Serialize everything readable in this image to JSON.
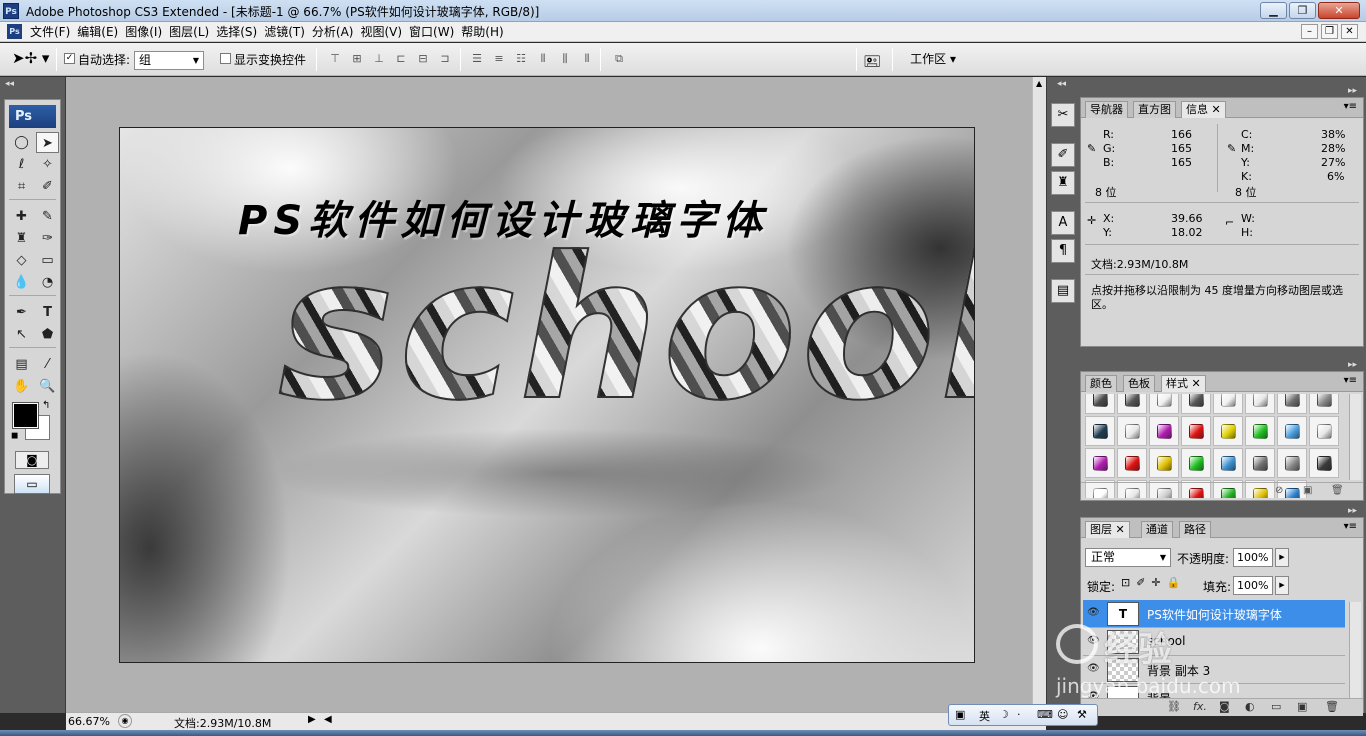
{
  "window": {
    "logo": "Ps",
    "title": "Adobe Photoshop CS3 Extended - [未标题-1 @ 66.7% (PS软件如何设计玻璃字体, RGB/8)]",
    "btn_min": "▁",
    "btn_max": "❐",
    "btn_close": "✕"
  },
  "menu": {
    "items": [
      "文件(F)",
      "编辑(E)",
      "图像(I)",
      "图层(L)",
      "选择(S)",
      "滤镜(T)",
      "分析(A)",
      "视图(V)",
      "窗口(W)",
      "帮助(H)"
    ],
    "doc_min": "–",
    "doc_max": "❐",
    "doc_close": "✕"
  },
  "options": {
    "auto_select_label": "自动选择:",
    "auto_select_value": "组",
    "show_transform_label": "显示变换控件",
    "workspace_label": "工作区 ▾"
  },
  "canvas": {
    "title_text": "PS软件如何设计玻璃字体",
    "school_text": "school"
  },
  "status": {
    "zoom": "66.67%",
    "doc": "文档:2.93M/10.8M"
  },
  "info_panel": {
    "tabs": [
      "导航器",
      "直方图",
      "信息"
    ],
    "r_label": "R:",
    "r_value": "166",
    "g_label": "G:",
    "g_value": "165",
    "b_label": "B:",
    "b_value": "165",
    "bit_left": "8 位",
    "c_label": "C:",
    "c_value": "38%",
    "m_label": "M:",
    "m_value": "28%",
    "y_label": "Y:",
    "y_value": "27%",
    "k_label": "K:",
    "k_value": "6%",
    "bit_right": "8 位",
    "x_label": "X:",
    "x_value": "39.66",
    "yy_label": "Y:",
    "yy_value": "18.02",
    "w_label": "W:",
    "h_label": "H:",
    "doc_size": "文档:2.93M/10.8M",
    "hint": "点按并拖移以沿限制为 45 度增量方向移动图层或选区。"
  },
  "styles_panel": {
    "tabs": [
      "颜色",
      "色板",
      "样式"
    ],
    "swatch_colors": [
      "#4a4a4a",
      "#555555",
      "#f0f0f0",
      "#555555",
      "#f0f0f0",
      "#e8e8e8",
      "#707070",
      "#8a8a8a",
      "#1d3c52",
      "#e8e8e8",
      "#b01bb0",
      "#e01010",
      "#e0d000",
      "#20c020",
      "#4aa0e0",
      "#e8e8e8",
      "#b01bb0",
      "#e01010",
      "#e0c000",
      "#20c020",
      "#3a90d0",
      "#707070",
      "#888888",
      "#3a3a3a",
      "#ffffff",
      "#e8e8e8",
      "#cccccc",
      "#e01010",
      "#20b020",
      "#e0c000",
      "#2a80d0"
    ]
  },
  "layers_panel": {
    "tabs": [
      "图层",
      "通道",
      "路径"
    ],
    "blend_mode": "正常",
    "opacity_label": "不透明度:",
    "opacity_value": "100%",
    "lock_label": "锁定:",
    "fill_label": "填充:",
    "fill_value": "100%",
    "layers": [
      {
        "name": "PS软件如何设计玻璃字体",
        "thumb": "T",
        "selected": true
      },
      {
        "name": "school",
        "thumb": "",
        "selected": false
      },
      {
        "name": "背景 副本 3",
        "thumb": "",
        "selected": false
      },
      {
        "name": "背景",
        "thumb": "",
        "selected": false
      }
    ]
  },
  "ime": {
    "lang": "英"
  },
  "watermark": {
    "brand": "经验",
    "url": "jingyan.baidu.com"
  }
}
